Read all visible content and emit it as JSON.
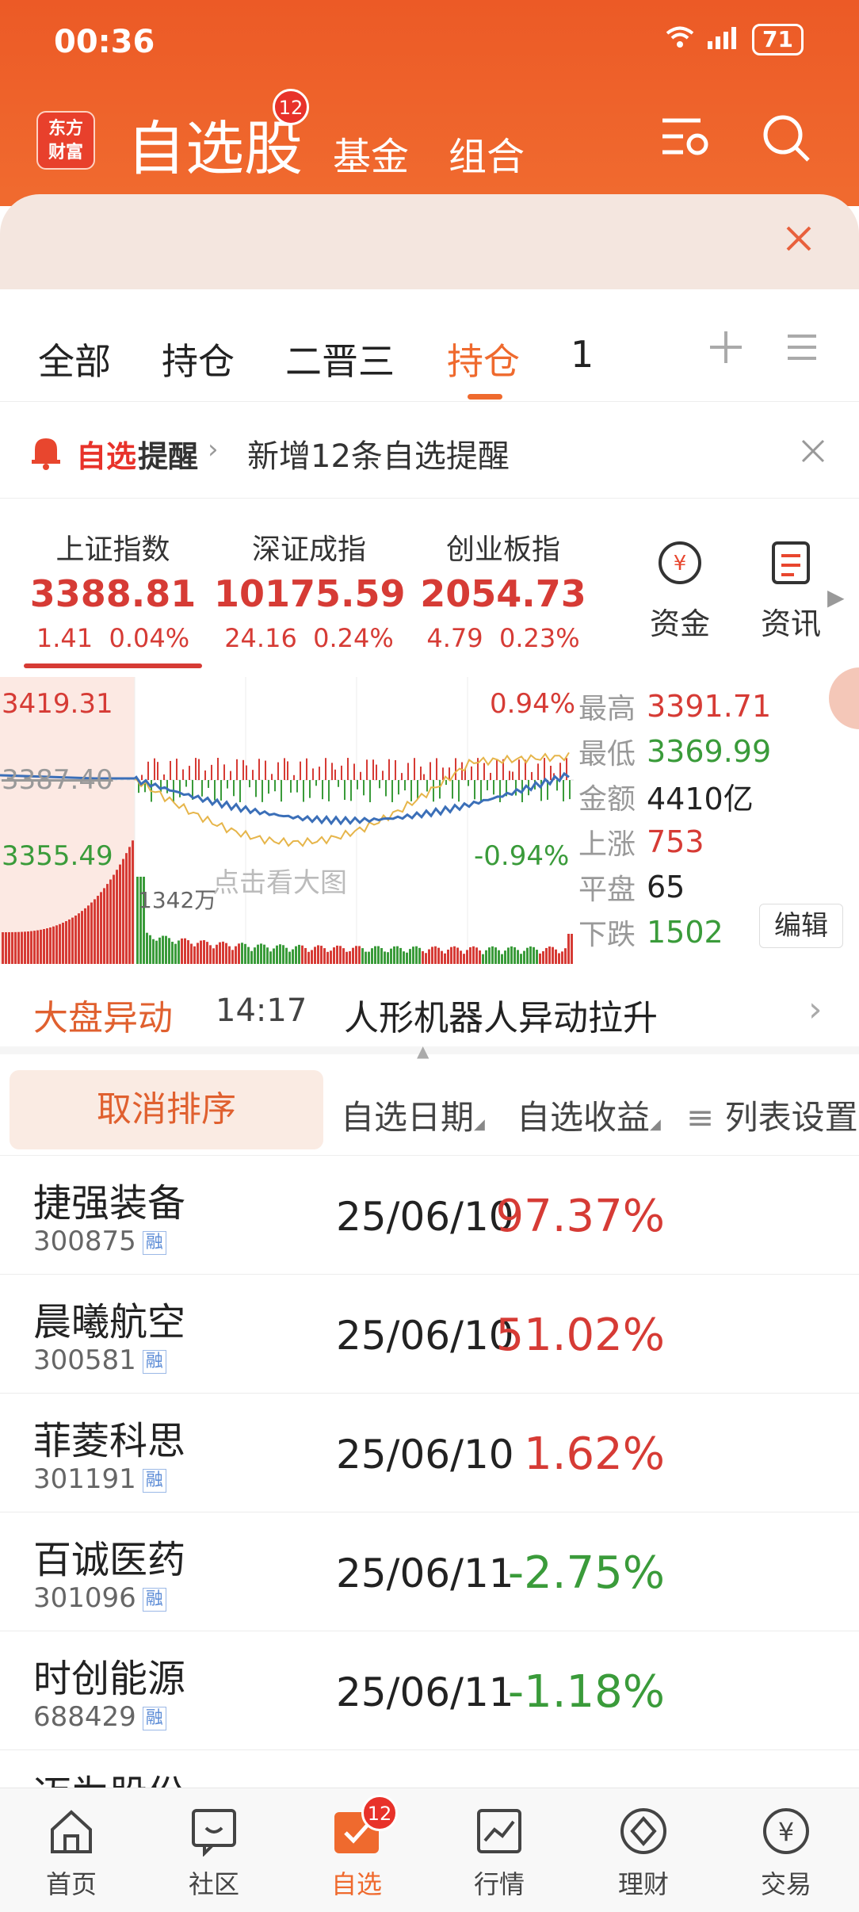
{
  "status": {
    "time": "00:36",
    "battery": "71"
  },
  "header": {
    "logo_text": "东方财富",
    "title": "自选股",
    "badge": "12",
    "tabs": [
      "基金",
      "组合"
    ]
  },
  "tabs": [
    "全部",
    "持仓",
    "二晋三",
    "持仓",
    "1"
  ],
  "reminder": {
    "tag_a": "自选",
    "tag_b": "提醒",
    "text": "新增12条自选提醒"
  },
  "indices": [
    {
      "name": "上证指数",
      "value": "3388.81",
      "change": "1.41",
      "pct": "0.04%"
    },
    {
      "name": "深证成指",
      "value": "10175.59",
      "change": "24.16",
      "pct": "0.24%"
    },
    {
      "name": "创业板指",
      "value": "2054.73",
      "change": "4.79",
      "pct": "0.23%"
    }
  ],
  "quick_buttons": [
    "资金",
    "资讯"
  ],
  "chart_data": {
    "type": "line",
    "y_labels": {
      "top": "3419.31",
      "mid": "3387.40",
      "bottom": "3355.49"
    },
    "pct_labels": {
      "top": "0.94%",
      "bottom": "-0.94%"
    },
    "volume_label": "1342万",
    "hint": "点击看大图"
  },
  "stats": [
    {
      "label": "最高",
      "value": "3391.71",
      "color": "red"
    },
    {
      "label": "最低",
      "value": "3369.99",
      "color": "green"
    },
    {
      "label": "金额",
      "value": "4410亿",
      "color": "black"
    },
    {
      "label": "上涨",
      "value": "753",
      "color": "red"
    },
    {
      "label": "平盘",
      "value": "65",
      "color": "black"
    },
    {
      "label": "下跌",
      "value": "1502",
      "color": "green"
    }
  ],
  "edit_label": "编辑",
  "anomaly": {
    "title": "大盘异动",
    "time": "14:17",
    "text": "人形机器人异动拉升"
  },
  "list_header": {
    "cancel": "取消排序",
    "date": "自选日期",
    "return": "自选收益",
    "settings": "列表设置"
  },
  "rong": "融",
  "stocks": [
    {
      "name": "捷强装备",
      "code": "300875",
      "date": "25/06/10",
      "ret": "97.37%",
      "up": true
    },
    {
      "name": "晨曦航空",
      "code": "300581",
      "date": "25/06/10",
      "ret": "51.02%",
      "up": true
    },
    {
      "name": "菲菱科思",
      "code": "301191",
      "date": "25/06/10",
      "ret": "1.62%",
      "up": true
    },
    {
      "name": "百诚医药",
      "code": "301096",
      "date": "25/06/11",
      "ret": "-2.75%",
      "up": false
    },
    {
      "name": "时创能源",
      "code": "688429",
      "date": "25/06/11",
      "ret": "-1.18%",
      "up": false
    }
  ],
  "partial_row": "迈为股份",
  "nav": [
    {
      "label": "首页"
    },
    {
      "label": "社区"
    },
    {
      "label": "自选",
      "badge": "12"
    },
    {
      "label": "行情"
    },
    {
      "label": "理财"
    },
    {
      "label": "交易"
    }
  ],
  "colors": {
    "accent": "#ef6a2e",
    "up": "#d63b35",
    "down": "#3a9b3a"
  }
}
